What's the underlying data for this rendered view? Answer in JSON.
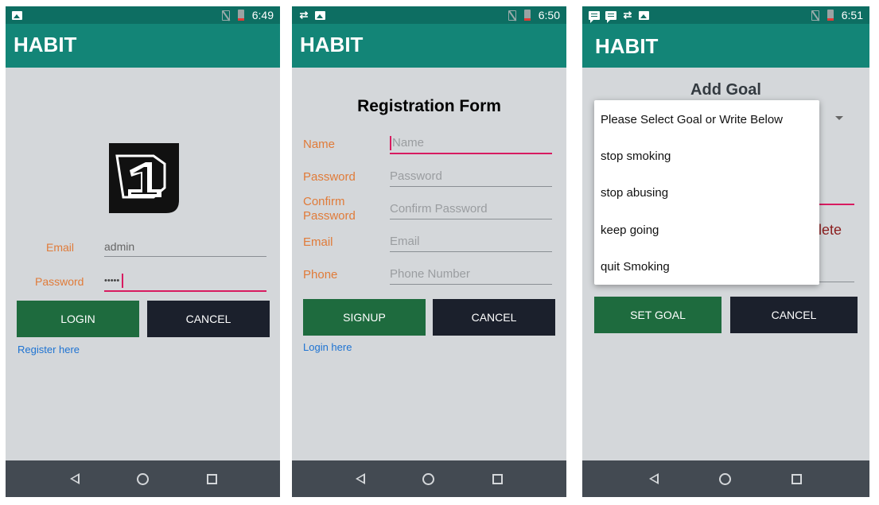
{
  "app_title": "HABIT",
  "colors": {
    "status_bar": "#0d6e62",
    "app_bar": "#138577",
    "background": "#d4d7da",
    "label_orange": "#e07b39",
    "button_green": "#1e6b3e",
    "button_dark": "#1b202c",
    "link_blue": "#1e73d2",
    "focus_pink": "#d81b60",
    "nav_bar": "#434a52"
  },
  "screens": {
    "login": {
      "status_time": "6:49",
      "status_icons": [
        "image-icon",
        "no-sim-icon",
        "battery-icon"
      ],
      "logo_icon": "number-one-logo-icon",
      "email_label": "Email",
      "email_value": "admin",
      "password_label": "Password",
      "password_value": "•••••",
      "login_button": "LOGIN",
      "cancel_button": "CANCEL",
      "register_link": "Register here"
    },
    "register": {
      "status_time": "6:50",
      "status_icons": [
        "sync-icon",
        "image-icon",
        "no-sim-icon",
        "battery-icon"
      ],
      "title": "Registration Form",
      "fields": [
        {
          "label": "Name",
          "placeholder": "Name"
        },
        {
          "label": "Password",
          "placeholder": "Password"
        },
        {
          "label": "Confirm\nPassword",
          "placeholder": "Confirm Password"
        },
        {
          "label": "Email",
          "placeholder": "Email"
        },
        {
          "label": "Phone",
          "placeholder": "Phone Number"
        }
      ],
      "signup_button": "SIGNUP",
      "cancel_button": "CANCEL",
      "login_link": "Login here"
    },
    "goal": {
      "status_time": "6:51",
      "status_icons": [
        "message-icon",
        "message-icon",
        "sync-icon",
        "image-icon",
        "no-sim-icon",
        "battery-icon"
      ],
      "title": "Add Goal",
      "background_partial_text": "lete",
      "dropdown_options": [
        "Please Select Goal or Write Below",
        "stop smoking",
        "stop abusing",
        "keep going",
        "quit Smoking"
      ],
      "set_goal_button": "SET GOAL",
      "cancel_button": "CANCEL"
    }
  }
}
